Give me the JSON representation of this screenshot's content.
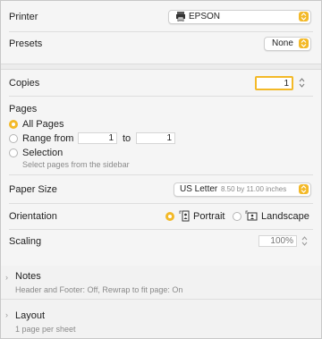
{
  "printer": {
    "label": "Printer",
    "value": "EPSON"
  },
  "presets": {
    "label": "Presets",
    "value": "None"
  },
  "copies": {
    "label": "Copies",
    "value": "1"
  },
  "pages": {
    "label": "Pages",
    "all_label": "All Pages",
    "range_label": "Range from",
    "range_from": "1",
    "to_label": "to",
    "range_to": "1",
    "selection_label": "Selection",
    "selection_hint": "Select pages from the sidebar"
  },
  "paper_size": {
    "label": "Paper Size",
    "value": "US Letter",
    "detail": "8.50 by 11.00 inches"
  },
  "orientation": {
    "label": "Orientation",
    "portrait": "Portrait",
    "landscape": "Landscape",
    "selected": "Portrait"
  },
  "scaling": {
    "label": "Scaling",
    "value": "100%"
  },
  "notes": {
    "title": "Notes",
    "summary": "Header and Footer: Off, Rewrap to fit page: On"
  },
  "layout": {
    "title": "Layout",
    "summary": "1 page per sheet"
  },
  "colors": {
    "accent": "#f3b928"
  }
}
